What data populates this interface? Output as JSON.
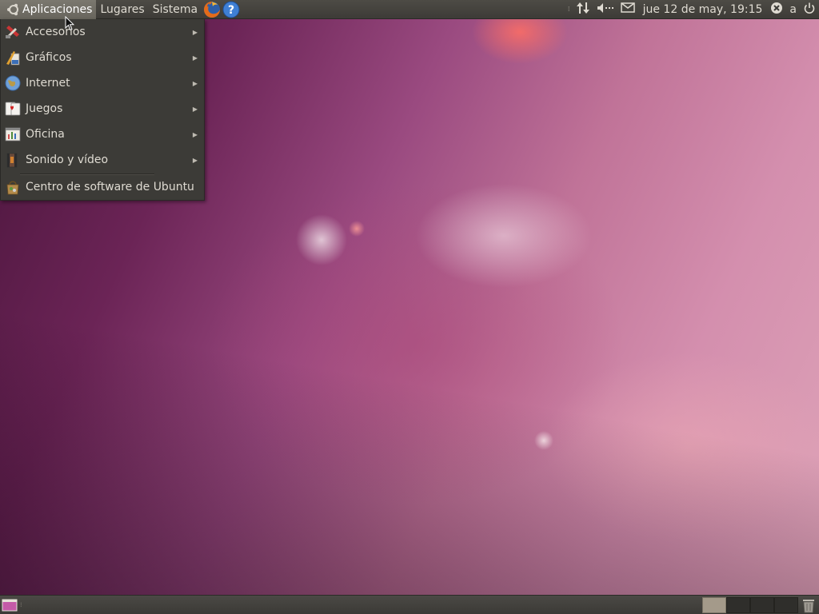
{
  "top_panel": {
    "menus": {
      "applications": "Aplicaciones",
      "places": "Lugares",
      "system": "Sistema"
    },
    "launchers": [
      "firefox-icon",
      "help-icon"
    ],
    "tray": {
      "network_icon": "network-updown-icon",
      "volume_icon": "volume-muted-icon",
      "mail_icon": "mail-envelope-icon",
      "clock": "jue 12 de may, 19:15",
      "user_status_icon": "user-offline-icon",
      "user_name": "a",
      "power_icon": "power-icon"
    }
  },
  "apps_menu": {
    "items": [
      {
        "label": "Accesorios",
        "icon": "accessories-icon",
        "submenu": true
      },
      {
        "label": "Gráficos",
        "icon": "graphics-icon",
        "submenu": true
      },
      {
        "label": "Internet",
        "icon": "internet-icon",
        "submenu": true
      },
      {
        "label": "Juegos",
        "icon": "games-icon",
        "submenu": true
      },
      {
        "label": "Oficina",
        "icon": "office-icon",
        "submenu": true
      },
      {
        "label": "Sonido y vídeo",
        "icon": "sound-video-icon",
        "submenu": true
      }
    ],
    "software_center": {
      "label": "Centro de software de Ubuntu",
      "icon": "software-center-icon"
    }
  },
  "bottom_panel": {
    "workspaces": 4,
    "active_workspace": 1
  },
  "colors": {
    "panel": "#3c3b37",
    "panel_text": "#dfdbd2",
    "active_menu": "#6f6c64",
    "wallpaper_dark": "#48143a",
    "wallpaper_light": "#dea4b8"
  }
}
